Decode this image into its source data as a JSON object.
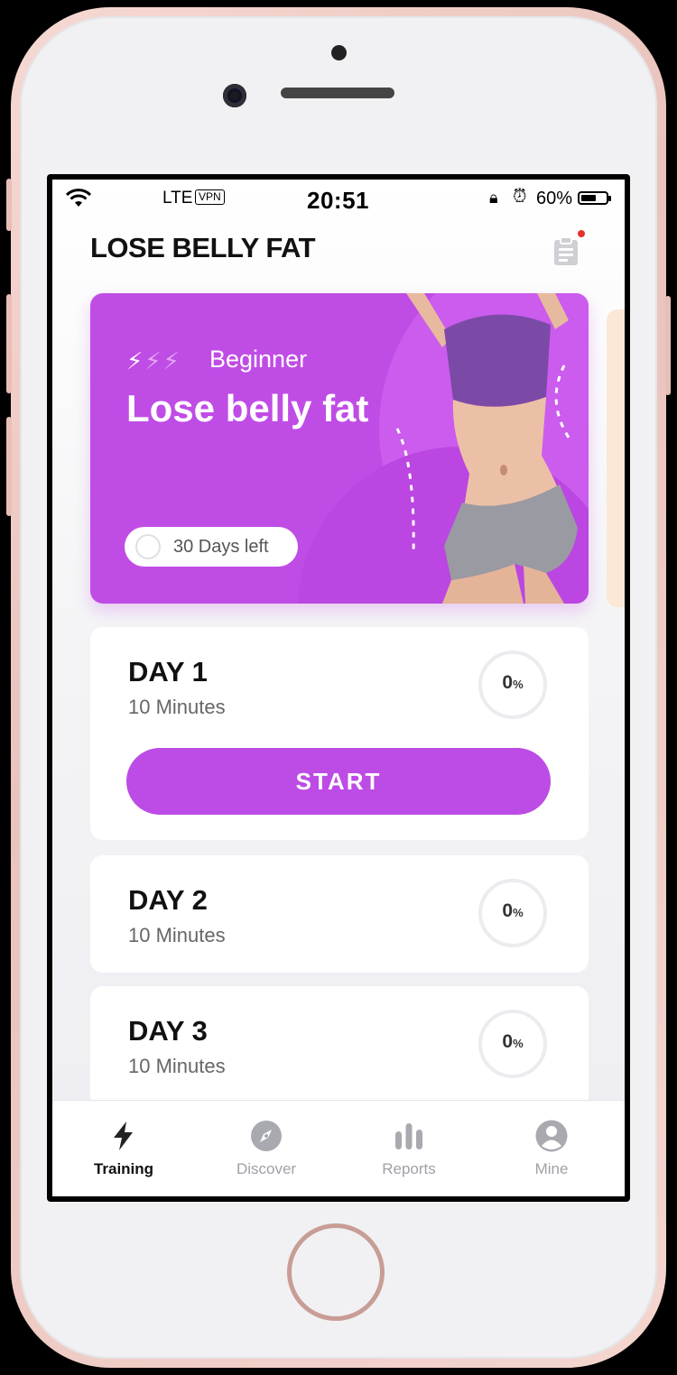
{
  "status_bar": {
    "carrier": "LTE",
    "vpn": "VPN",
    "time": "20:51",
    "battery": "60%",
    "battery_level": 0.6
  },
  "header": {
    "title": "LOSE BELLY FAT",
    "plan_icon": "clipboard-icon",
    "has_notification": true
  },
  "hero": {
    "level": "Beginner",
    "level_bolts_active": 1,
    "level_bolts_total": 3,
    "title": "Lose belly fat",
    "days_left": "30 Days left",
    "color": "#c04ce6"
  },
  "days": [
    {
      "title": "DAY 1",
      "duration": "10 Minutes",
      "progress": "0",
      "unit": "%"
    },
    {
      "title": "DAY 2",
      "duration": "10 Minutes",
      "progress": "0",
      "unit": "%"
    },
    {
      "title": "DAY 3",
      "duration": "10 Minutes",
      "progress": "0",
      "unit": "%"
    }
  ],
  "start_button": {
    "label": "START",
    "color": "#bd4be5"
  },
  "tabbar": {
    "tabs": [
      {
        "label": "Training",
        "icon": "bolt-icon",
        "active": true
      },
      {
        "label": "Discover",
        "icon": "compass-icon",
        "active": false
      },
      {
        "label": "Reports",
        "icon": "bar-chart-icon",
        "active": false
      },
      {
        "label": "Mine",
        "icon": "user-icon",
        "active": false
      }
    ]
  }
}
